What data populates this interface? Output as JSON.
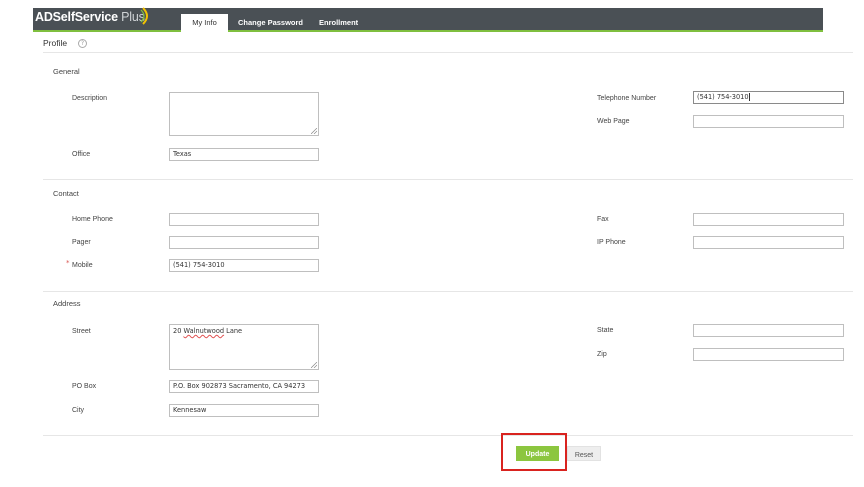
{
  "app": {
    "logo_text": "ADSelfService",
    "logo_plus": "Plus",
    "colors": {
      "header_bg": "#4a5055",
      "accent_green": "#8cc63f",
      "highlight_red": "#d9231f"
    }
  },
  "tabs": [
    {
      "label": "My Info",
      "active": true
    },
    {
      "label": "Change Password",
      "active": false
    },
    {
      "label": "Enrollment",
      "active": false
    }
  ],
  "page": {
    "title": "Profile",
    "help_icon": "question-circle-icon"
  },
  "general": {
    "title": "General",
    "description_label": "Description",
    "description_value": "",
    "office_label": "Office",
    "office_value": "Texas",
    "telephone_label": "Telephone Number",
    "telephone_value": "(541) 754-3010",
    "webpage_label": "Web Page",
    "webpage_value": ""
  },
  "contact": {
    "title": "Contact",
    "home_phone_label": "Home Phone",
    "home_phone_value": "",
    "pager_label": "Pager",
    "pager_value": "",
    "mobile_required": "*",
    "mobile_label": "Mobile",
    "mobile_value": "(541) 754-3010",
    "fax_label": "Fax",
    "fax_value": "",
    "ip_phone_label": "IP Phone",
    "ip_phone_value": ""
  },
  "address": {
    "title": "Address",
    "street_label": "Street",
    "street_prefix": "20 ",
    "street_word": "Walnutwood",
    "street_suffix": " Lane",
    "pobox_label": "PO Box",
    "pobox_value": "P.O. Box 902873 Sacramento, CA 94273",
    "city_label": "City",
    "city_value": "Kennesaw",
    "state_label": "State",
    "state_value": "",
    "zip_label": "Zip",
    "zip_value": ""
  },
  "actions": {
    "update_label": "Update",
    "reset_label": "Reset"
  }
}
